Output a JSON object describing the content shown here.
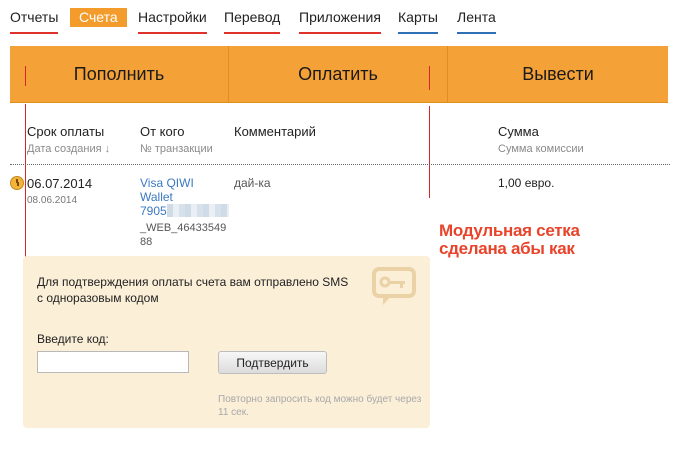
{
  "nav": {
    "items": [
      {
        "label": "Отчеты"
      },
      {
        "label": "Счета"
      },
      {
        "label": "Настройки"
      },
      {
        "label": "Перевод"
      },
      {
        "label": "Приложения"
      },
      {
        "label": "Карты"
      },
      {
        "label": "Лента"
      }
    ],
    "active_index": 1
  },
  "actions": {
    "topup_label": "Пополнить",
    "pay_label": "Оплатить",
    "withdraw_label": "Вывести"
  },
  "table": {
    "headers": {
      "due_date": "Срок оплаты",
      "created_date": "Дата создания ↓",
      "from": "От кого",
      "transaction": "№ транзакции",
      "comment": "Комментарий",
      "amount": "Сумма",
      "commission": "Сумма комиссии"
    },
    "rows": [
      {
        "due_date": "06.07.2014",
        "created_date": "08.06.2014",
        "from_line1": "Visa QIWI",
        "from_line2": "Wallet",
        "from_line3": "7905",
        "transaction_line1": "_WEB_46433549",
        "transaction_line2": "88",
        "comment": "дай-ка",
        "amount": "1,00 евро."
      }
    ]
  },
  "annotation": {
    "line1": "Модульная сетка",
    "line2": "сделана абы как"
  },
  "confirm_panel": {
    "message": "Для подтверждения оплаты счета вам отправлено SMS с одноразовым кодом",
    "code_label": "Введите код:",
    "code_value": "",
    "confirm_label": "Подтвердить",
    "resend_note": "Повторно запросить код можно будет через 11 сек."
  },
  "colors": {
    "accent": "#f4a237",
    "annotation": "#e8432b",
    "link": "#3b78c3",
    "panel_bg": "#fbefd8"
  }
}
